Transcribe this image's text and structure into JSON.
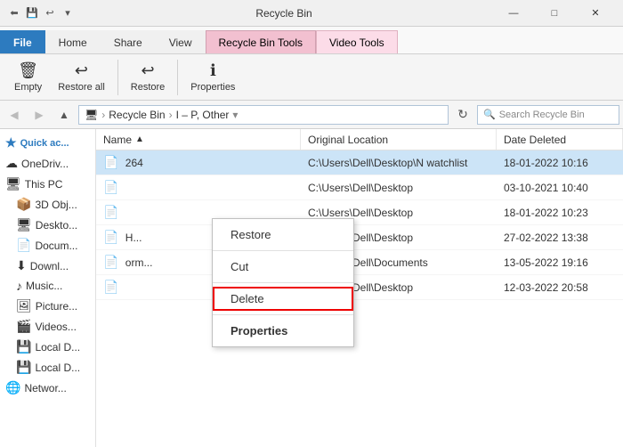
{
  "titleBar": {
    "title": "Recycle Bin",
    "controls": [
      "—",
      "□",
      "✕"
    ]
  },
  "ribbon": {
    "tabs": [
      {
        "label": "File",
        "style": "active-blue"
      },
      {
        "label": "Home",
        "style": "inactive"
      },
      {
        "label": "Share",
        "style": "inactive"
      },
      {
        "label": "View",
        "style": "inactive"
      },
      {
        "label": "Recycle Bin Tools",
        "style": "active-pink"
      },
      {
        "label": "Video Tools",
        "style": "active-light-pink"
      }
    ]
  },
  "addressBar": {
    "pathIcon": "🖥",
    "path1": "Recycle Bin",
    "path2": "I – P, Other",
    "searchPlaceholder": "Search Recycle Bin",
    "refreshIcon": "↻"
  },
  "sidebar": {
    "items": [
      {
        "label": "Quick ac...",
        "icon": "⚡",
        "section": true
      },
      {
        "label": "OneDriv...",
        "icon": "☁"
      },
      {
        "label": "This PC",
        "icon": "🖥"
      },
      {
        "label": "3D Obj...",
        "icon": "📦"
      },
      {
        "label": "Deskto...",
        "icon": "🖥"
      },
      {
        "label": "Docum...",
        "icon": "📄"
      },
      {
        "label": "Downl...",
        "icon": "⬇"
      },
      {
        "label": "Music...",
        "icon": "♪"
      },
      {
        "label": "Picture...",
        "icon": "🖼"
      },
      {
        "label": "Videos...",
        "icon": "🎬"
      },
      {
        "label": "Local D...",
        "icon": "💾"
      },
      {
        "label": "Local D...",
        "icon": "💾"
      },
      {
        "label": "Networ...",
        "icon": "🌐"
      }
    ]
  },
  "fileList": {
    "columns": [
      {
        "label": "Name",
        "sortArrow": "▲"
      },
      {
        "label": "Original Location",
        "sortArrow": ""
      },
      {
        "label": "Date Deleted",
        "sortArrow": ""
      }
    ],
    "rows": [
      {
        "icon": "📄",
        "name": "...",
        "extra": "264",
        "location": "C:\\Users\\Dell\\Desktop\\N watchlist",
        "date": "18-01-2022 10:16",
        "selected": true
      },
      {
        "icon": "📄",
        "name": "...",
        "extra": "",
        "location": "C:\\Users\\Dell\\Desktop",
        "date": "03-10-2021 10:40"
      },
      {
        "icon": "📄",
        "name": "...",
        "extra": "",
        "location": "C:\\Users\\Dell\\Desktop",
        "date": "18-01-2022 10:23"
      },
      {
        "icon": "📄",
        "name": "...",
        "extra": "H...",
        "location": "C:\\Users\\Dell\\Desktop",
        "date": "27-02-2022 13:38"
      },
      {
        "icon": "📄",
        "name": "...",
        "extra": "orm...",
        "location": "C:\\Users\\Dell\\Documents",
        "date": "13-05-2022 19:16"
      },
      {
        "icon": "📄",
        "name": "...",
        "extra": "",
        "location": "C:\\Users\\Dell\\Desktop",
        "date": "12-03-2022 20:58"
      }
    ]
  },
  "contextMenu": {
    "items": [
      {
        "label": "Restore",
        "style": "normal"
      },
      {
        "label": "Cut",
        "style": "normal"
      },
      {
        "label": "Delete",
        "style": "highlighted"
      },
      {
        "label": "Properties",
        "style": "bold"
      }
    ]
  }
}
